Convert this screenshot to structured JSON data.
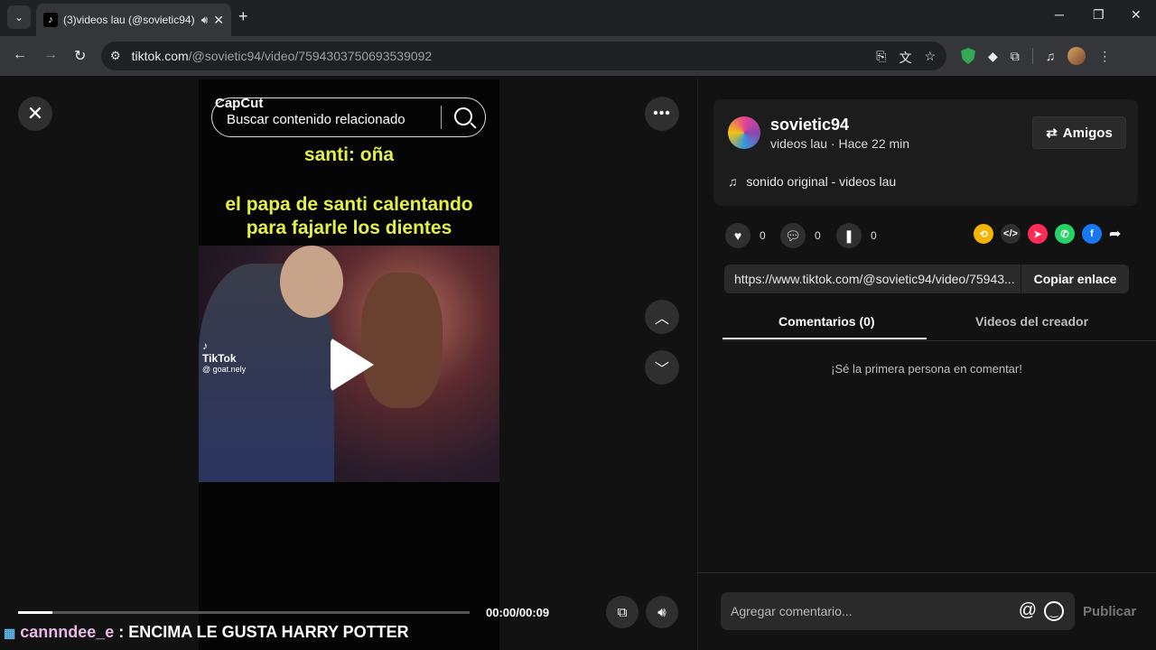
{
  "browser": {
    "tab_title": "(3)videos lau (@sovietic94)",
    "url_host": "tiktok.com",
    "url_path": "/@sovietic94/video/7594303750693539092",
    "new_tab": "+",
    "win_min": "─",
    "win_restore": "❐",
    "win_close": "✕"
  },
  "video": {
    "watermark": "CapCut",
    "search_placeholder": "Buscar contenido relacionado",
    "caption_1": "santi: oña",
    "caption_2_line1": "el papa de santi calentando",
    "caption_2_line2": "para fajarle los dientes",
    "tiktok_label": "TikTok",
    "tiktok_handle": "@ goat.nely",
    "time": "00:00/00:09",
    "progress_fraction": 0.075
  },
  "chat_overlay": {
    "username": "cannndee_e",
    "separator": " : ",
    "message": "ENCIMA LE GUSTA HARRY POTTER"
  },
  "post": {
    "author": "sovietic94",
    "subtitle": "videos lau · Hace 22 min",
    "friends_button": "Amigos",
    "music": "sonido original - videos lau",
    "likes": "0",
    "comments": "0",
    "saves": "0",
    "link": "https://www.tiktok.com/@sovietic94/video/75943...",
    "copy_button": "Copiar enlace"
  },
  "tabs": {
    "comments": "Comentarios (0)",
    "creator_videos": "Videos del creador"
  },
  "comments": {
    "empty": "¡Sé la primera persona en comentar!",
    "input_placeholder": "Agregar comentario...",
    "publish": "Publicar"
  },
  "colors": {
    "caption_yellow": "#e4f04a",
    "chat_user": "#e9b7e6",
    "background": "#121212"
  }
}
